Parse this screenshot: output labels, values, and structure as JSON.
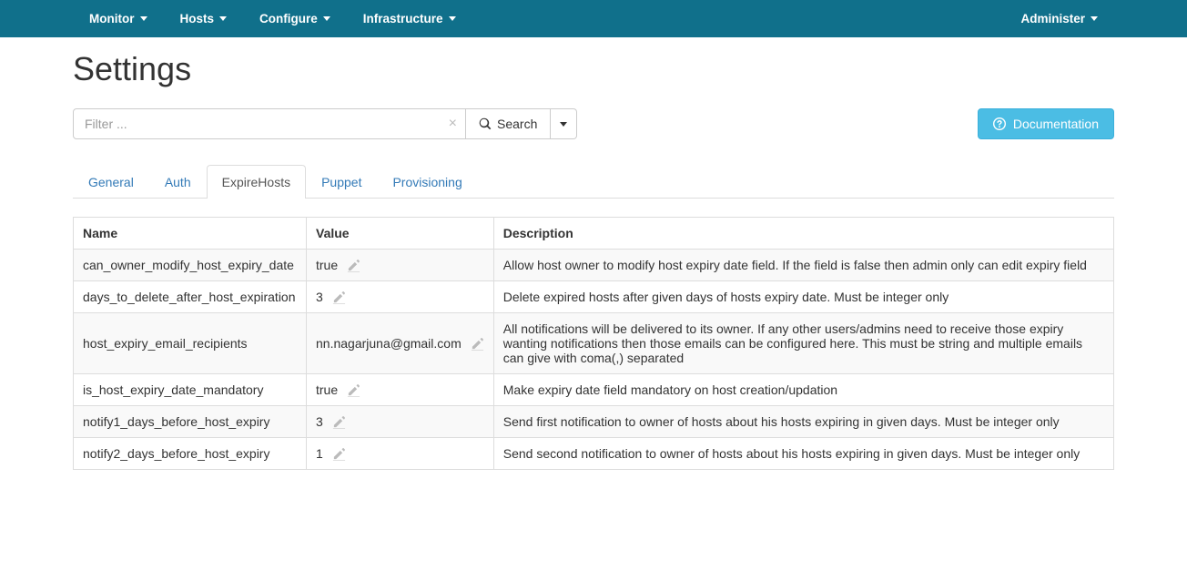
{
  "nav": {
    "left": [
      "Monitor",
      "Hosts",
      "Configure",
      "Infrastructure"
    ],
    "right": [
      "Administer"
    ]
  },
  "page": {
    "title": "Settings"
  },
  "search": {
    "placeholder": "Filter ...",
    "button": "Search"
  },
  "doc_button": "Documentation",
  "tabs": [
    {
      "label": "General",
      "active": false
    },
    {
      "label": "Auth",
      "active": false
    },
    {
      "label": "ExpireHosts",
      "active": true
    },
    {
      "label": "Puppet",
      "active": false
    },
    {
      "label": "Provisioning",
      "active": false
    }
  ],
  "table": {
    "headers": {
      "name": "Name",
      "value": "Value",
      "description": "Description"
    },
    "rows": [
      {
        "name": "can_owner_modify_host_expiry_date",
        "value": "true",
        "description": "Allow host owner to modify host expiry date field. If the field is false then admin only can edit expiry field"
      },
      {
        "name": "days_to_delete_after_host_expiration",
        "value": "3",
        "description": "Delete expired hosts after given days of hosts expiry date. Must be integer only"
      },
      {
        "name": "host_expiry_email_recipients",
        "value": "nn.nagarjuna@gmail.com",
        "description": "All notifications will be delivered to its owner. If any other users/admins need to receive those expiry wanting notifications then those emails can be configured here. This must be string and multiple emails can give with coma(,) separated"
      },
      {
        "name": "is_host_expiry_date_mandatory",
        "value": "true",
        "description": "Make expiry date field mandatory on host creation/updation"
      },
      {
        "name": "notify1_days_before_host_expiry",
        "value": "3",
        "description": "Send first notification to owner of hosts about his hosts expiring in given days. Must be integer only"
      },
      {
        "name": "notify2_days_before_host_expiry",
        "value": "1",
        "description": "Send second notification to owner of hosts about his hosts expiring in given days. Must be integer only"
      }
    ]
  }
}
